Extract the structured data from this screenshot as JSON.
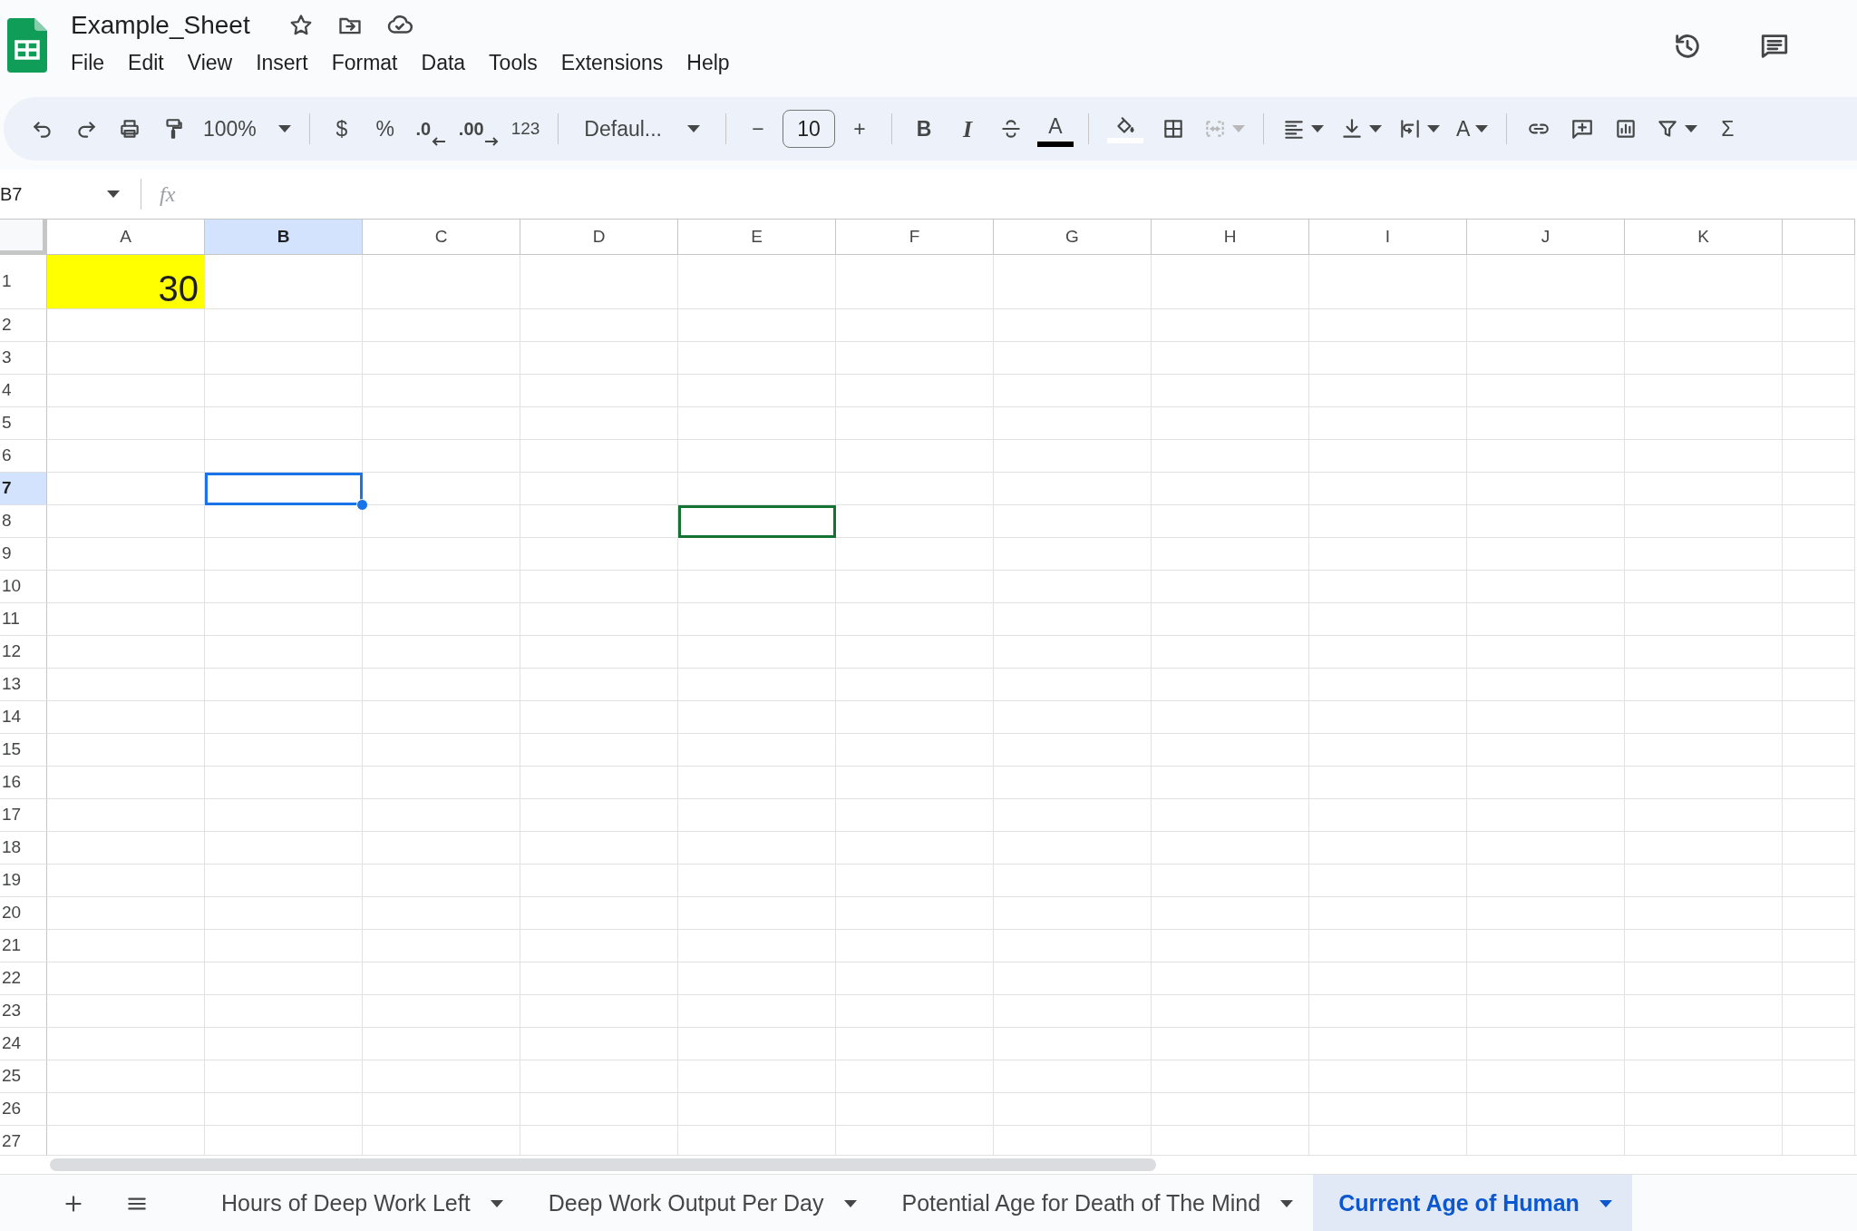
{
  "document": {
    "title": "Example_Sheet"
  },
  "menu": [
    "File",
    "Edit",
    "View",
    "Insert",
    "Format",
    "Data",
    "Tools",
    "Extensions",
    "Help"
  ],
  "toolbar": {
    "zoom": "100%",
    "currency": "$",
    "percent": "%",
    "decrease_decimals": ".0",
    "increase_decimals": ".00",
    "number_format": "123",
    "font": "Defaul...",
    "font_size_minus": "−",
    "font_size": "10",
    "font_size_plus": "+",
    "bold": "B",
    "italic": "I",
    "text_color": "A",
    "merge_cells": {
      "disabled": true
    },
    "text_rotation": "A",
    "functions": "Σ"
  },
  "formula_bar": {
    "name_box": "B7",
    "fx": "fx"
  },
  "columns": [
    {
      "label": "A",
      "selected": false
    },
    {
      "label": "B",
      "selected": true
    },
    {
      "label": "C",
      "selected": false
    },
    {
      "label": "D",
      "selected": false
    },
    {
      "label": "E",
      "selected": false
    },
    {
      "label": "F",
      "selected": false
    },
    {
      "label": "G",
      "selected": false
    },
    {
      "label": "H",
      "selected": false
    },
    {
      "label": "I",
      "selected": false
    },
    {
      "label": "J",
      "selected": false
    },
    {
      "label": "K",
      "selected": false
    }
  ],
  "rows": [
    {
      "label": "1",
      "selected": false,
      "cells": [
        {
          "value": "30",
          "color": "#ffff00",
          "selected": false,
          "other_user_cursor": false
        }
      ]
    },
    {
      "label": "2",
      "selected": false
    },
    {
      "label": "3",
      "selected": false
    },
    {
      "label": "4",
      "selected": false
    },
    {
      "label": "5",
      "selected": false
    },
    {
      "label": "6",
      "selected": false
    },
    {
      "label": "7",
      "selected": true,
      "cells": [
        {
          "selected": false,
          "other_user_cursor": false
        },
        {
          "selected": true,
          "other_user_cursor": false
        }
      ]
    },
    {
      "label": "8",
      "selected": false,
      "cells": [
        {
          "selected": false,
          "other_user_cursor": false
        },
        {
          "selected": false,
          "other_user_cursor": false
        },
        {
          "selected": false,
          "other_user_cursor": false
        },
        {
          "selected": false,
          "other_user_cursor": false
        },
        {
          "selected": false,
          "other_user_cursor": true
        }
      ]
    },
    {
      "label": "9",
      "selected": false
    },
    {
      "label": "10",
      "selected": false
    },
    {
      "label": "11",
      "selected": false
    },
    {
      "label": "12",
      "selected": false
    },
    {
      "label": "13",
      "selected": false
    },
    {
      "label": "14",
      "selected": false
    },
    {
      "label": "15",
      "selected": false
    },
    {
      "label": "16",
      "selected": false
    },
    {
      "label": "17",
      "selected": false
    },
    {
      "label": "18",
      "selected": false
    },
    {
      "label": "19",
      "selected": false
    },
    {
      "label": "20",
      "selected": false
    },
    {
      "label": "21",
      "selected": false
    },
    {
      "label": "22",
      "selected": false
    },
    {
      "label": "23",
      "selected": false
    },
    {
      "label": "24",
      "selected": false
    },
    {
      "label": "25",
      "selected": false
    },
    {
      "label": "26",
      "selected": false
    },
    {
      "label": "27",
      "selected": false
    }
  ],
  "sheet_tabs": [
    {
      "label": "Hours of Deep Work Left",
      "selected": false
    },
    {
      "label": "Deep Work Output Per Day",
      "selected": false
    },
    {
      "label": "Potential Age for Death of The Mind",
      "selected": false
    },
    {
      "label": "Current Age of Human",
      "selected": true
    }
  ]
}
